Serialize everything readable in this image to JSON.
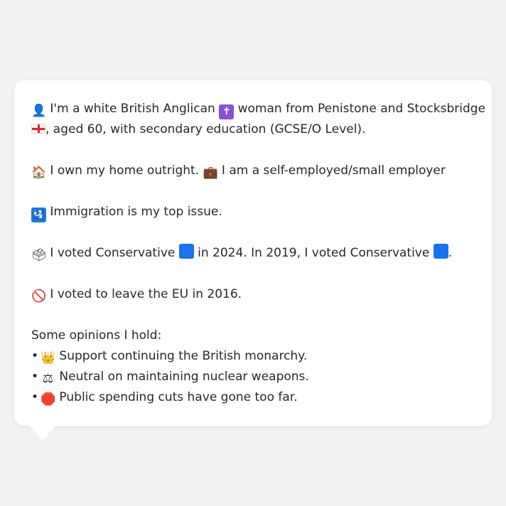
{
  "card": {
    "p1": {
      "icon1": "person-silhouette-icon",
      "text_a": " I'm a white British Anglican ",
      "icon2": "latin-cross-icon",
      "text_b": " woman from Penistone and Stocksbridge",
      "icon3": "england-flag-icon",
      "text_c": ", aged 60, with secondary education (GCSE/O Level)."
    },
    "p2": {
      "icon1": "house-icon",
      "text_a": " I own my home outright. ",
      "icon2": "briefcase-icon",
      "text_b": " I am a self-employed/small employer"
    },
    "p3": {
      "icon": "passport-control-icon",
      "text": " Immigration is my top issue."
    },
    "p4": {
      "icon1": "ballot-box-icon",
      "text_a": " I voted Conservative ",
      "icon2": "blue-square-icon",
      "text_b": " in 2024. In 2019, I voted Conservative ",
      "icon3": "blue-square-icon",
      "text_c": "."
    },
    "p5": {
      "icon": "prohibited-icon",
      "text": " I voted to leave the EU in 2016."
    },
    "opinions": {
      "heading": "Some opinions I hold:",
      "bullet": "•",
      "items": [
        {
          "icon": "crown-icon",
          "text": " Support continuing the British monarchy."
        },
        {
          "icon": "balance-scale-icon",
          "text": " Neutral on maintaining nuclear weapons."
        },
        {
          "icon": "stop-sign-icon",
          "text": " Public spending cuts have gone too far."
        }
      ]
    }
  },
  "colors": {
    "background": "#f2f3f5",
    "card": "#ffffff",
    "text": "#24282f",
    "blue_square": "#1a73e8"
  }
}
